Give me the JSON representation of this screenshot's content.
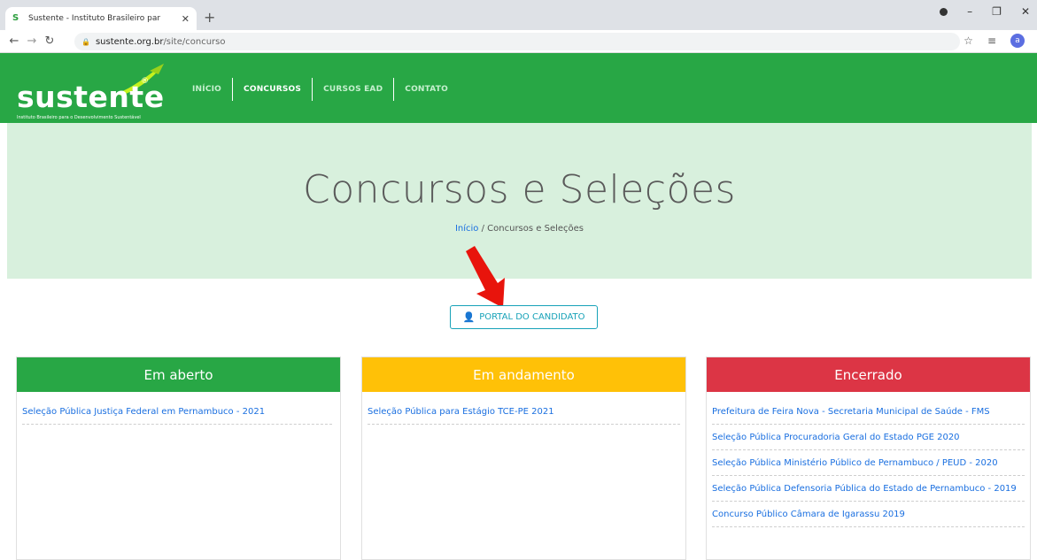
{
  "browser": {
    "tab_title": "Sustente - Instituto Brasileiro par",
    "favicon": "S",
    "new_tab": "+",
    "url_host": "sustente.org.br",
    "url_path": "/site/concurso",
    "profile_initial": "a"
  },
  "header": {
    "logo_text": "sustente",
    "logo_reg": "®",
    "logo_tagline": "Instituto Brasileiro para o Desenvolvimento Sustentável",
    "nav": [
      {
        "label": "INÍCIO"
      },
      {
        "label": "CONCURSOS"
      },
      {
        "label": "CURSOS EAD"
      },
      {
        "label": "CONTATO"
      }
    ]
  },
  "hero": {
    "title": "Concursos e Seleções",
    "breadcrumb_home": "Início",
    "breadcrumb_sep": " / ",
    "breadcrumb_current": "Concursos e Seleções"
  },
  "portal_button": "PORTAL DO CANDIDATO",
  "cards": {
    "open": {
      "title": "Em aberto",
      "color": "#28a745",
      "items": [
        "Seleção Pública Justiça Federal em Pernambuco - 2021"
      ]
    },
    "ongoing": {
      "title": "Em andamento",
      "color": "#ffc107",
      "items": [
        "Seleção Pública para Estágio TCE-PE 2021"
      ]
    },
    "closed": {
      "title": "Encerrado",
      "color": "#dc3545",
      "items": [
        "Prefeitura de Feira Nova - Secretaria Municipal de Saúde - FMS",
        "Seleção Pública Procuradoria Geral do Estado PGE 2020",
        "Seleção Pública Ministério Público de Pernambuco / PEUD - 2020",
        "Seleção Pública Defensoria Pública do Estado de Pernambuco - 2019",
        "Concurso Público Câmara de Igarassu 2019"
      ]
    }
  },
  "colors": {
    "header_green": "#28a745",
    "hero_bg": "#d8f0dd",
    "link_blue": "#1a6fe0",
    "portal_teal": "#17a2b8",
    "arrow_red": "#e8140c"
  }
}
